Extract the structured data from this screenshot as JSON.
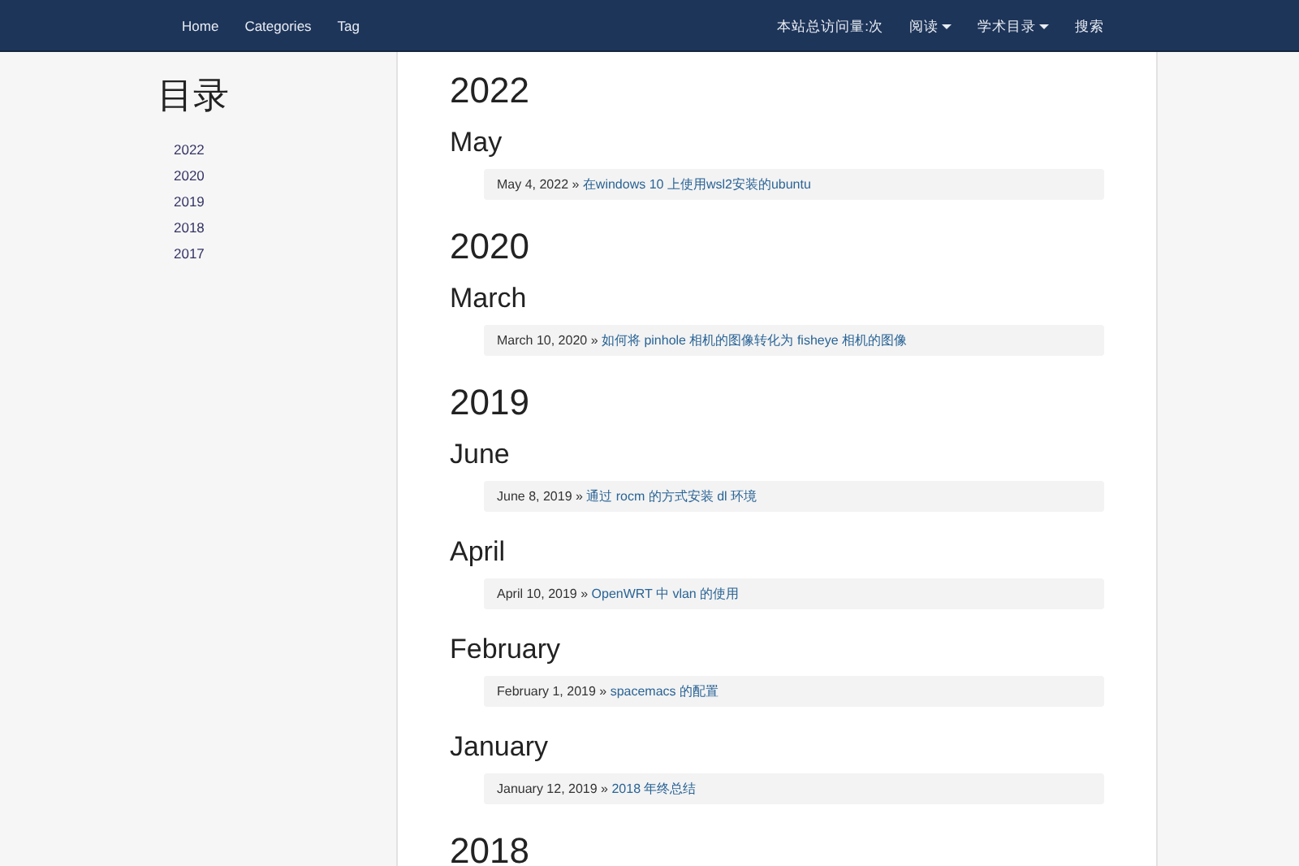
{
  "navbar": {
    "left_links": [
      {
        "label": "Home"
      },
      {
        "label": "Categories"
      },
      {
        "label": "Tag"
      }
    ],
    "right_items": [
      {
        "label": "本站总访问量:次",
        "dropdown": false
      },
      {
        "label": "阅读",
        "dropdown": true
      },
      {
        "label": "学术目录",
        "dropdown": true
      },
      {
        "label": "搜索",
        "dropdown": false
      }
    ]
  },
  "sidebar": {
    "title": "目录",
    "items": [
      {
        "label": "2022"
      },
      {
        "label": "2020"
      },
      {
        "label": "2019"
      },
      {
        "label": "2018"
      },
      {
        "label": "2017"
      }
    ]
  },
  "archive": [
    {
      "year": "2022",
      "months": [
        {
          "month": "May",
          "posts": [
            {
              "date": "May 4, 2022",
              "separator": "»",
              "title": "在windows 10 上使用wsl2安装的ubuntu"
            }
          ]
        }
      ]
    },
    {
      "year": "2020",
      "months": [
        {
          "month": "March",
          "posts": [
            {
              "date": "March 10, 2020",
              "separator": "»",
              "title": "如何将 pinhole 相机的图像转化为 fisheye 相机的图像"
            }
          ]
        }
      ]
    },
    {
      "year": "2019",
      "months": [
        {
          "month": "June",
          "posts": [
            {
              "date": "June 8, 2019",
              "separator": "»",
              "title": "通过 rocm 的方式安装 dl 环境"
            }
          ]
        },
        {
          "month": "April",
          "posts": [
            {
              "date": "April 10, 2019",
              "separator": "»",
              "title": "OpenWRT 中 vlan 的使用"
            }
          ]
        },
        {
          "month": "February",
          "posts": [
            {
              "date": "February 1, 2019",
              "separator": "»",
              "title": "spacemacs 的配置"
            }
          ]
        },
        {
          "month": "January",
          "posts": [
            {
              "date": "January 12, 2019",
              "separator": "»",
              "title": "2018 年终总结"
            }
          ]
        }
      ]
    },
    {
      "year": "2018"
    }
  ]
}
